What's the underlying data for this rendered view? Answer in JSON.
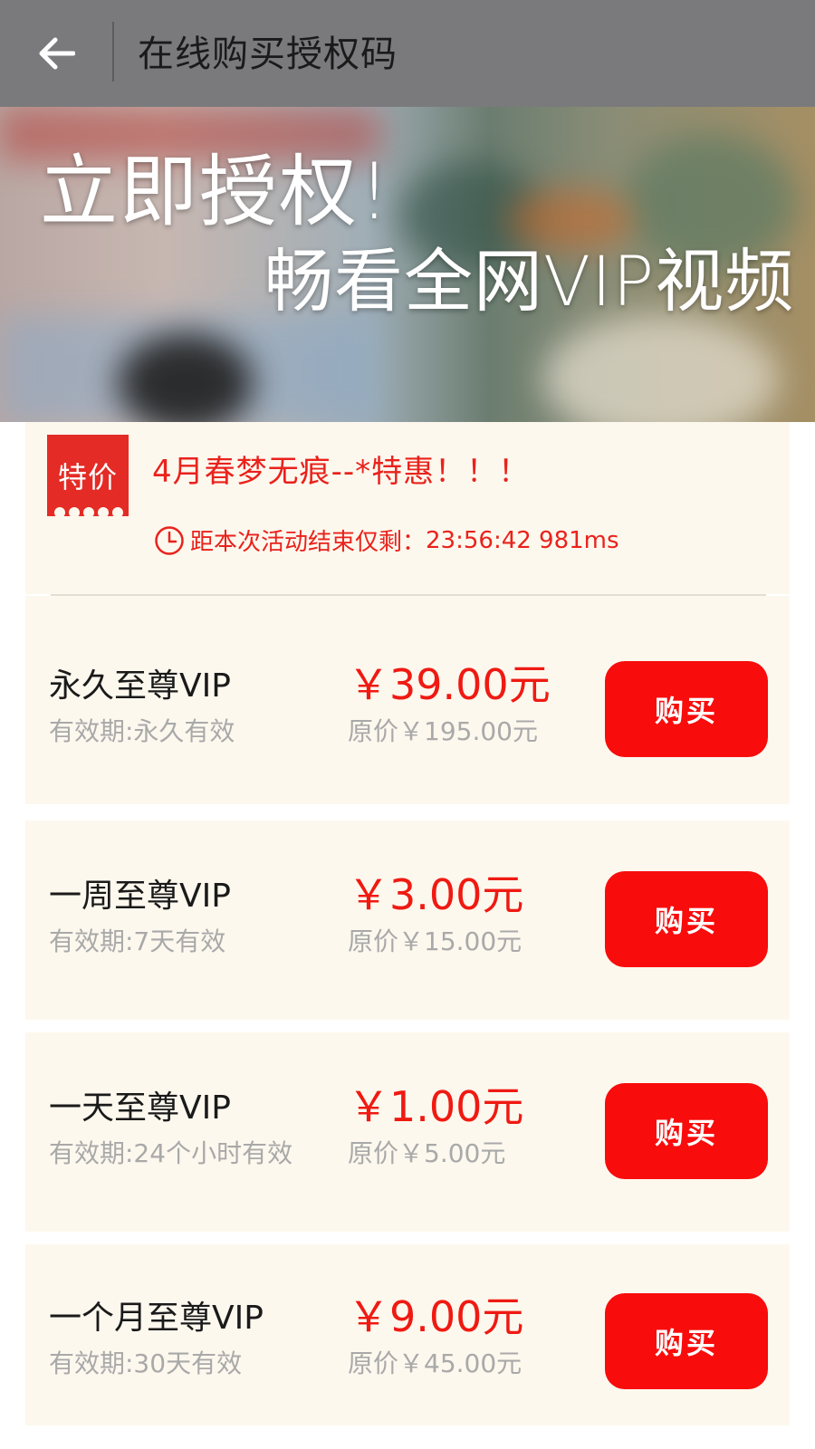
{
  "header": {
    "title": "在线购买授权码"
  },
  "banner": {
    "line1": "立即授权!",
    "line2": "畅看全网VIP视频"
  },
  "promo": {
    "tag": "特价",
    "title": "4月春梦无痕--*特惠！！！",
    "countdown_label": "距本次活动结束仅剩：",
    "countdown_value": "23:56:42 981ms"
  },
  "products": [
    {
      "name": "永久至尊VIP",
      "validity": "有效期:永久有效",
      "price": "￥39.00元",
      "original": "原价￥195.00元",
      "buy": "购买"
    },
    {
      "name": "一周至尊VIP",
      "validity": "有效期:7天有效",
      "price": "￥3.00元",
      "original": "原价￥15.00元",
      "buy": "购买"
    },
    {
      "name": "一天至尊VIP",
      "validity": "有效期:24个小时有效",
      "price": "￥1.00元",
      "original": "原价￥5.00元",
      "buy": "购买"
    },
    {
      "name": "一个月至尊VIP",
      "validity": "有效期:30天有效",
      "price": "￥9.00元",
      "original": "原价￥45.00元",
      "buy": "购买"
    }
  ],
  "colors": {
    "accent_red": "#ef1a12",
    "buy_button": "#f80c0c",
    "card_background": "#fdf8ee",
    "topbar": "#7a7a7c"
  }
}
